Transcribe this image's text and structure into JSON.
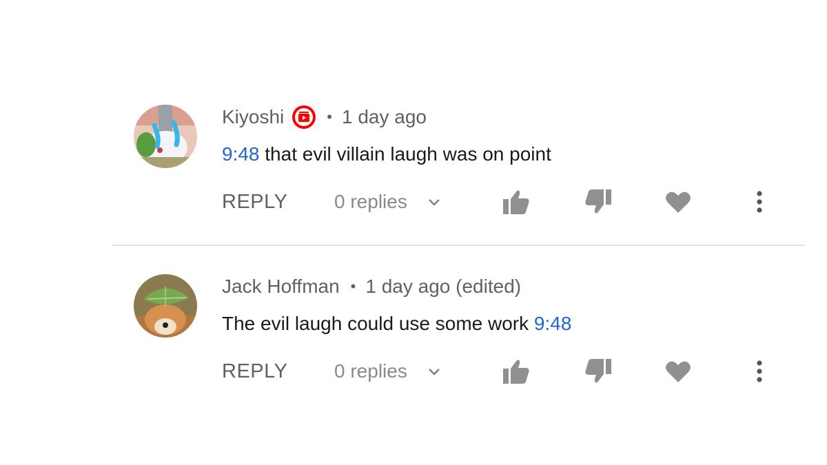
{
  "comments": [
    {
      "author": "Kiyoshi",
      "has_badge": true,
      "badge_icon": "creator-badge-icon",
      "badge_color": "#ff0000",
      "separator": "•",
      "time": "1 day ago",
      "text_prefix": "",
      "timestamp_link": "9:48",
      "text_suffix": " that evil villain laugh was on point",
      "reply_label": "REPLY",
      "replies_label": "0 replies",
      "icons": [
        "thumbs-up-icon",
        "thumbs-down-icon",
        "heart-icon",
        "more-vertical-icon"
      ]
    },
    {
      "author": "Jack Hoffman",
      "has_badge": false,
      "separator": "•",
      "time": "1 day ago (edited)",
      "text_prefix": "The evil laugh could use some work ",
      "timestamp_link": "9:48",
      "text_suffix": "",
      "reply_label": "REPLY",
      "replies_label": "0 replies",
      "icons": [
        "thumbs-up-icon",
        "thumbs-down-icon",
        "heart-icon",
        "more-vertical-icon"
      ]
    }
  ],
  "colors": {
    "link": "#2266cc",
    "icon": "#909090",
    "text": "#1a1a1a",
    "meta": "#606060"
  }
}
